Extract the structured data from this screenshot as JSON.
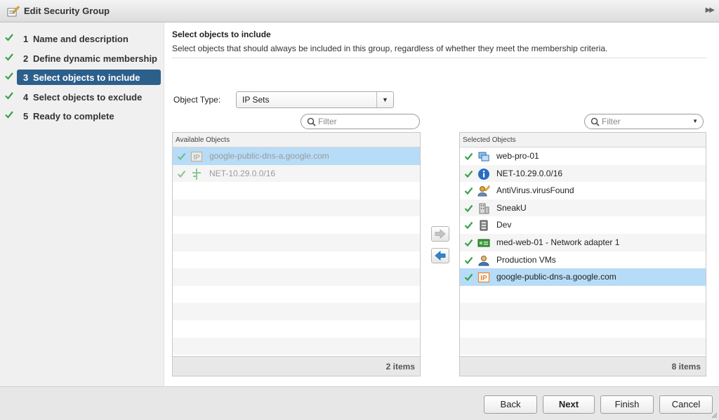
{
  "dialog": {
    "title": "Edit Security Group"
  },
  "steps": [
    {
      "num": "1",
      "label": "Name and description"
    },
    {
      "num": "2",
      "label": "Define dynamic membership"
    },
    {
      "num": "3",
      "label": "Select objects to include"
    },
    {
      "num": "4",
      "label": "Select objects to exclude"
    },
    {
      "num": "5",
      "label": "Ready to complete"
    }
  ],
  "active_step": "3",
  "content": {
    "heading": "Select objects to include",
    "description": "Select objects that should always be included in this group, regardless of whether they meet the membership criteria.",
    "object_type_label": "Object Type:",
    "object_type_value": "IP Sets"
  },
  "available": {
    "filter_placeholder": "Filter",
    "header": "Available Objects",
    "items": [
      {
        "label": "google-public-dns-a.google.com",
        "icon": "ip-set-icon"
      },
      {
        "label": "NET-10.29.0.0/16",
        "icon": "network-icon"
      }
    ],
    "count": "2 items"
  },
  "selected": {
    "filter_placeholder": "Filter",
    "header": "Selected Objects",
    "items": [
      {
        "label": "web-pro-01",
        "icon": "vm-icon"
      },
      {
        "label": "NET-10.29.0.0/16",
        "icon": "info-icon"
      },
      {
        "label": "AntiVirus.virusFound",
        "icon": "security-tag-icon"
      },
      {
        "label": "SneakU",
        "icon": "building-icon"
      },
      {
        "label": "Dev",
        "icon": "resource-pool-icon"
      },
      {
        "label": "med-web-01 - Network adapter 1",
        "icon": "network-adapter-icon"
      },
      {
        "label": "Production VMs",
        "icon": "user-group-icon"
      },
      {
        "label": "google-public-dns-a.google.com",
        "icon": "ip-set-icon"
      }
    ],
    "count": "8 items"
  },
  "buttons": {
    "back": "Back",
    "next": "Next",
    "finish": "Finish",
    "cancel": "Cancel"
  },
  "colors": {
    "accent": "#2d5f8b",
    "check": "#3aa14a",
    "selection": "#b7dcf7",
    "ip_orange": "#e8832b"
  }
}
